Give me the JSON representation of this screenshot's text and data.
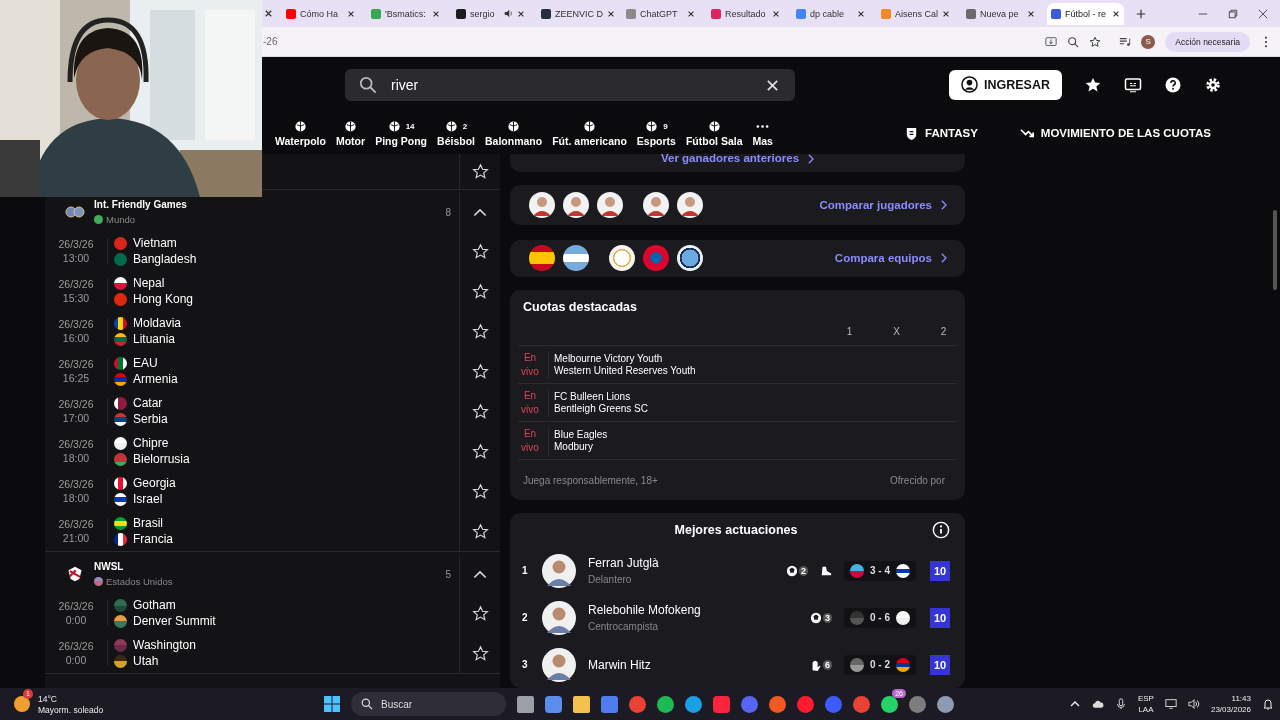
{
  "browser": {
    "tabs": [
      {
        "title": "Cómo Ha",
        "selected": false,
        "playing_audio": false
      },
      {
        "title": "'Bsmatics:",
        "selected": false,
        "playing_audio": false
      },
      {
        "title": "sergio",
        "selected": false,
        "playing_audio": true
      },
      {
        "title": "ZEENVIC D",
        "selected": false,
        "playing_audio": false
      },
      {
        "title": "ChatGPT",
        "selected": false,
        "playing_audio": false
      },
      {
        "title": "Resultado",
        "selected": false,
        "playing_audio": false
      },
      {
        "title": "dp cable",
        "selected": false,
        "playing_audio": false
      },
      {
        "title": "Aisens Cal",
        "selected": false,
        "playing_audio": false
      },
      {
        "title": "Nueva pe",
        "selected": false,
        "playing_audio": false
      },
      {
        "title": "Fútbol - re",
        "selected": true,
        "playing_audio": false
      }
    ],
    "address": "-26",
    "profile": "S",
    "action": "Acción necesaria"
  },
  "header": {
    "search": {
      "value": "river"
    },
    "login": "INGRESAR"
  },
  "sports_nav": [
    {
      "label": "Waterpolo"
    },
    {
      "label": "Motor"
    },
    {
      "label": "Ping Pong",
      "count": "14"
    },
    {
      "label": "Béisbol",
      "count": "2"
    },
    {
      "label": "Balonmano"
    },
    {
      "label": "Fút. americano"
    },
    {
      "label": "Esports",
      "count": "9"
    },
    {
      "label": "Fútbol Sala"
    },
    {
      "label": "Mas"
    }
  ],
  "nav_links": [
    "FANTASY",
    "MOVIMIENTO DE LAS CUOTAS"
  ],
  "leagues": [
    {
      "name": "Int. Friendly Games",
      "region": "Mundo",
      "count": "8",
      "expanded": true,
      "matches": [
        {
          "date": "26/3/26",
          "time": "13:00",
          "home": "Vietnam",
          "away": "Bangladesh"
        },
        {
          "date": "26/3/26",
          "time": "15:30",
          "home": "Nepal",
          "away": "Hong Kong"
        },
        {
          "date": "26/3/26",
          "time": "16:00",
          "home": "Moldavia",
          "away": "Lituania"
        },
        {
          "date": "26/3/26",
          "time": "16:25",
          "home": "EAU",
          "away": "Armenia"
        },
        {
          "date": "26/3/26",
          "time": "17:00",
          "home": "Catar",
          "away": "Serbia"
        },
        {
          "date": "26/3/26",
          "time": "18:00",
          "home": "Chipre",
          "away": "Bielorrusia"
        },
        {
          "date": "26/3/26",
          "time": "18:00",
          "home": "Georgia",
          "away": "Israel"
        },
        {
          "date": "26/3/26",
          "time": "21:00",
          "home": "Brasil",
          "away": "Francia"
        }
      ]
    },
    {
      "name": "NWSL",
      "region": "Estados Unidos",
      "count": "5",
      "expanded": true,
      "matches": [
        {
          "date": "26/3/26",
          "time": "0:00",
          "home": "Gotham",
          "away": "Denver Summit"
        },
        {
          "date": "26/3/26",
          "time": "0:00",
          "home": "Washington",
          "away": "Utah"
        }
      ]
    }
  ],
  "previous_winners": "Ver ganadores anteriores",
  "compare_players": "Comparar jugadores",
  "compare_teams": "Compara equipos",
  "odds": {
    "title": "Cuotas destacadas",
    "columns": [
      "1",
      "X",
      "2"
    ],
    "rows": [
      {
        "status": "En vivo",
        "home": "Melbourne Victory Youth",
        "away": "Western United Reserves Youth"
      },
      {
        "status": "En vivo",
        "home": "FC Bulleen Lions",
        "away": "Bentleigh Greens SC"
      },
      {
        "status": "En vivo",
        "home": "Blue Eagles",
        "away": "Modbury"
      }
    ],
    "note": "Juega responsablemente, 18+",
    "offered_by": "Ofrecido por"
  },
  "top_performances": {
    "title": "Mejores actuaciones",
    "players": [
      {
        "rank": "1",
        "name": "Ferran Jutglà",
        "position": "Delantero",
        "stats": [
          {
            "kind": "goals",
            "count": "2"
          },
          {
            "kind": "assist"
          }
        ],
        "score": "3 - 4",
        "rating": "10"
      },
      {
        "rank": "2",
        "name": "Relebohile Mofokeng",
        "position": "Centrocampista",
        "stats": [
          {
            "kind": "goals",
            "count": "3"
          }
        ],
        "score": "0 - 6",
        "rating": "10"
      },
      {
        "rank": "3",
        "name": "Marwin Hitz",
        "stats": [
          {
            "kind": "saves",
            "count": "6"
          }
        ],
        "score": "0 - 2",
        "rating": "10"
      }
    ]
  },
  "taskbar": {
    "weather": {
      "temp": "14°C",
      "summary": "Mayorm. soleado",
      "alert": "1"
    },
    "search": {
      "placeholder": "Buscar"
    },
    "app_badge": "26",
    "language": [
      "ESP",
      "LAA"
    ],
    "time": "11:43",
    "date": "23/03/2026"
  }
}
